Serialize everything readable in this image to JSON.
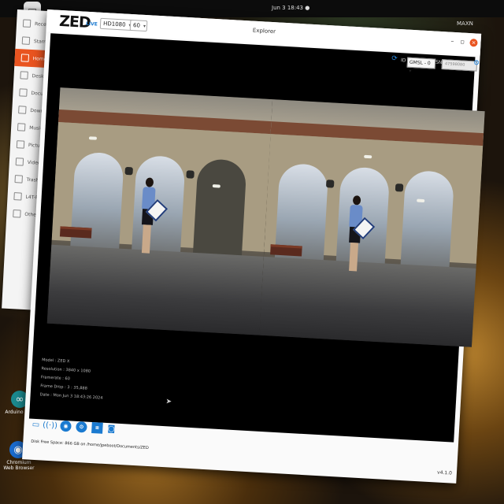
{
  "topbar": {
    "clock": "Jun 3 18:43 ●",
    "user": "MAXN"
  },
  "desktop": {
    "labels": [
      "Arduino IDE",
      "Chromium Web Browser"
    ]
  },
  "files": {
    "items": [
      {
        "label": "Recent"
      },
      {
        "label": "Starred"
      },
      {
        "label": "Home"
      },
      {
        "label": "Desktop"
      },
      {
        "label": "Documents"
      },
      {
        "label": "Downloads"
      },
      {
        "label": "Music"
      },
      {
        "label": "Pictures"
      },
      {
        "label": "Videos"
      },
      {
        "label": "Trash"
      },
      {
        "label": "L4T-README"
      },
      {
        "label": "Other Locations"
      }
    ]
  },
  "app": {
    "logo": "ZED",
    "logo_badge": "LIVE",
    "resolution_select": "HD1080",
    "fps_select": "60",
    "title": "Explorer",
    "camera": {
      "id_label": "ID",
      "id_value": "GMSL - 0",
      "sn_label": "SN",
      "sn_value": "47598080"
    },
    "info": {
      "model": "Model : ZED X",
      "resolution": "Resolution : 3840 x 1080",
      "framerate": "Framerate : 60",
      "frame_drop": "Frame Drop : 3 : 35,888",
      "date": "Date : Mon Jun 3 18:43:26 2024"
    },
    "status": "Disk Free Space: 866 GB  on /home/jpeboot/Documents/ZED",
    "version": "v4.1.0"
  },
  "colors": {
    "accent": "#1a7ad0",
    "ubuntu_orange": "#e95420"
  }
}
